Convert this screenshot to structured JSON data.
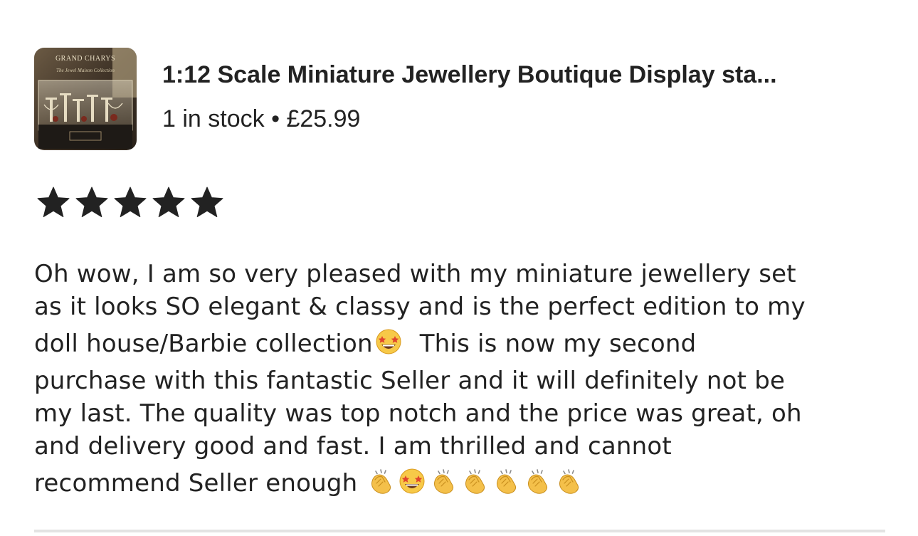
{
  "listing": {
    "title": "1:12 Scale Miniature Jewellery Boutique Display sta...",
    "stock": "1 in stock",
    "separator": "•",
    "price": "£25.99",
    "thumbnail": {
      "brand": "GRAND CHARYS",
      "tagline": "The Jewel Maison Collection"
    }
  },
  "rating": {
    "stars": 5,
    "max": 5,
    "star_color": "#222222"
  },
  "review": {
    "lines": [
      "Oh wow, I am so very pleased with my miniature jewellery set",
      "as it looks SO elegant & classy and is the perfect edition to my",
      "doll house/Barbie collection",
      "This is now my second",
      "purchase with this fantastic Seller and it will definitely not be",
      "my last.  The quality was top notch and the price was great, oh",
      "and delivery good and fast. I am thrilled and cannot",
      "recommend Seller enough"
    ],
    "emojis": {
      "line3": [
        "star-struck-icon"
      ],
      "line8": [
        "clapping-hands-icon",
        "star-struck-icon",
        "clapping-hands-icon",
        "clapping-hands-icon",
        "clapping-hands-icon",
        "clapping-hands-icon",
        "clapping-hands-icon"
      ]
    }
  }
}
